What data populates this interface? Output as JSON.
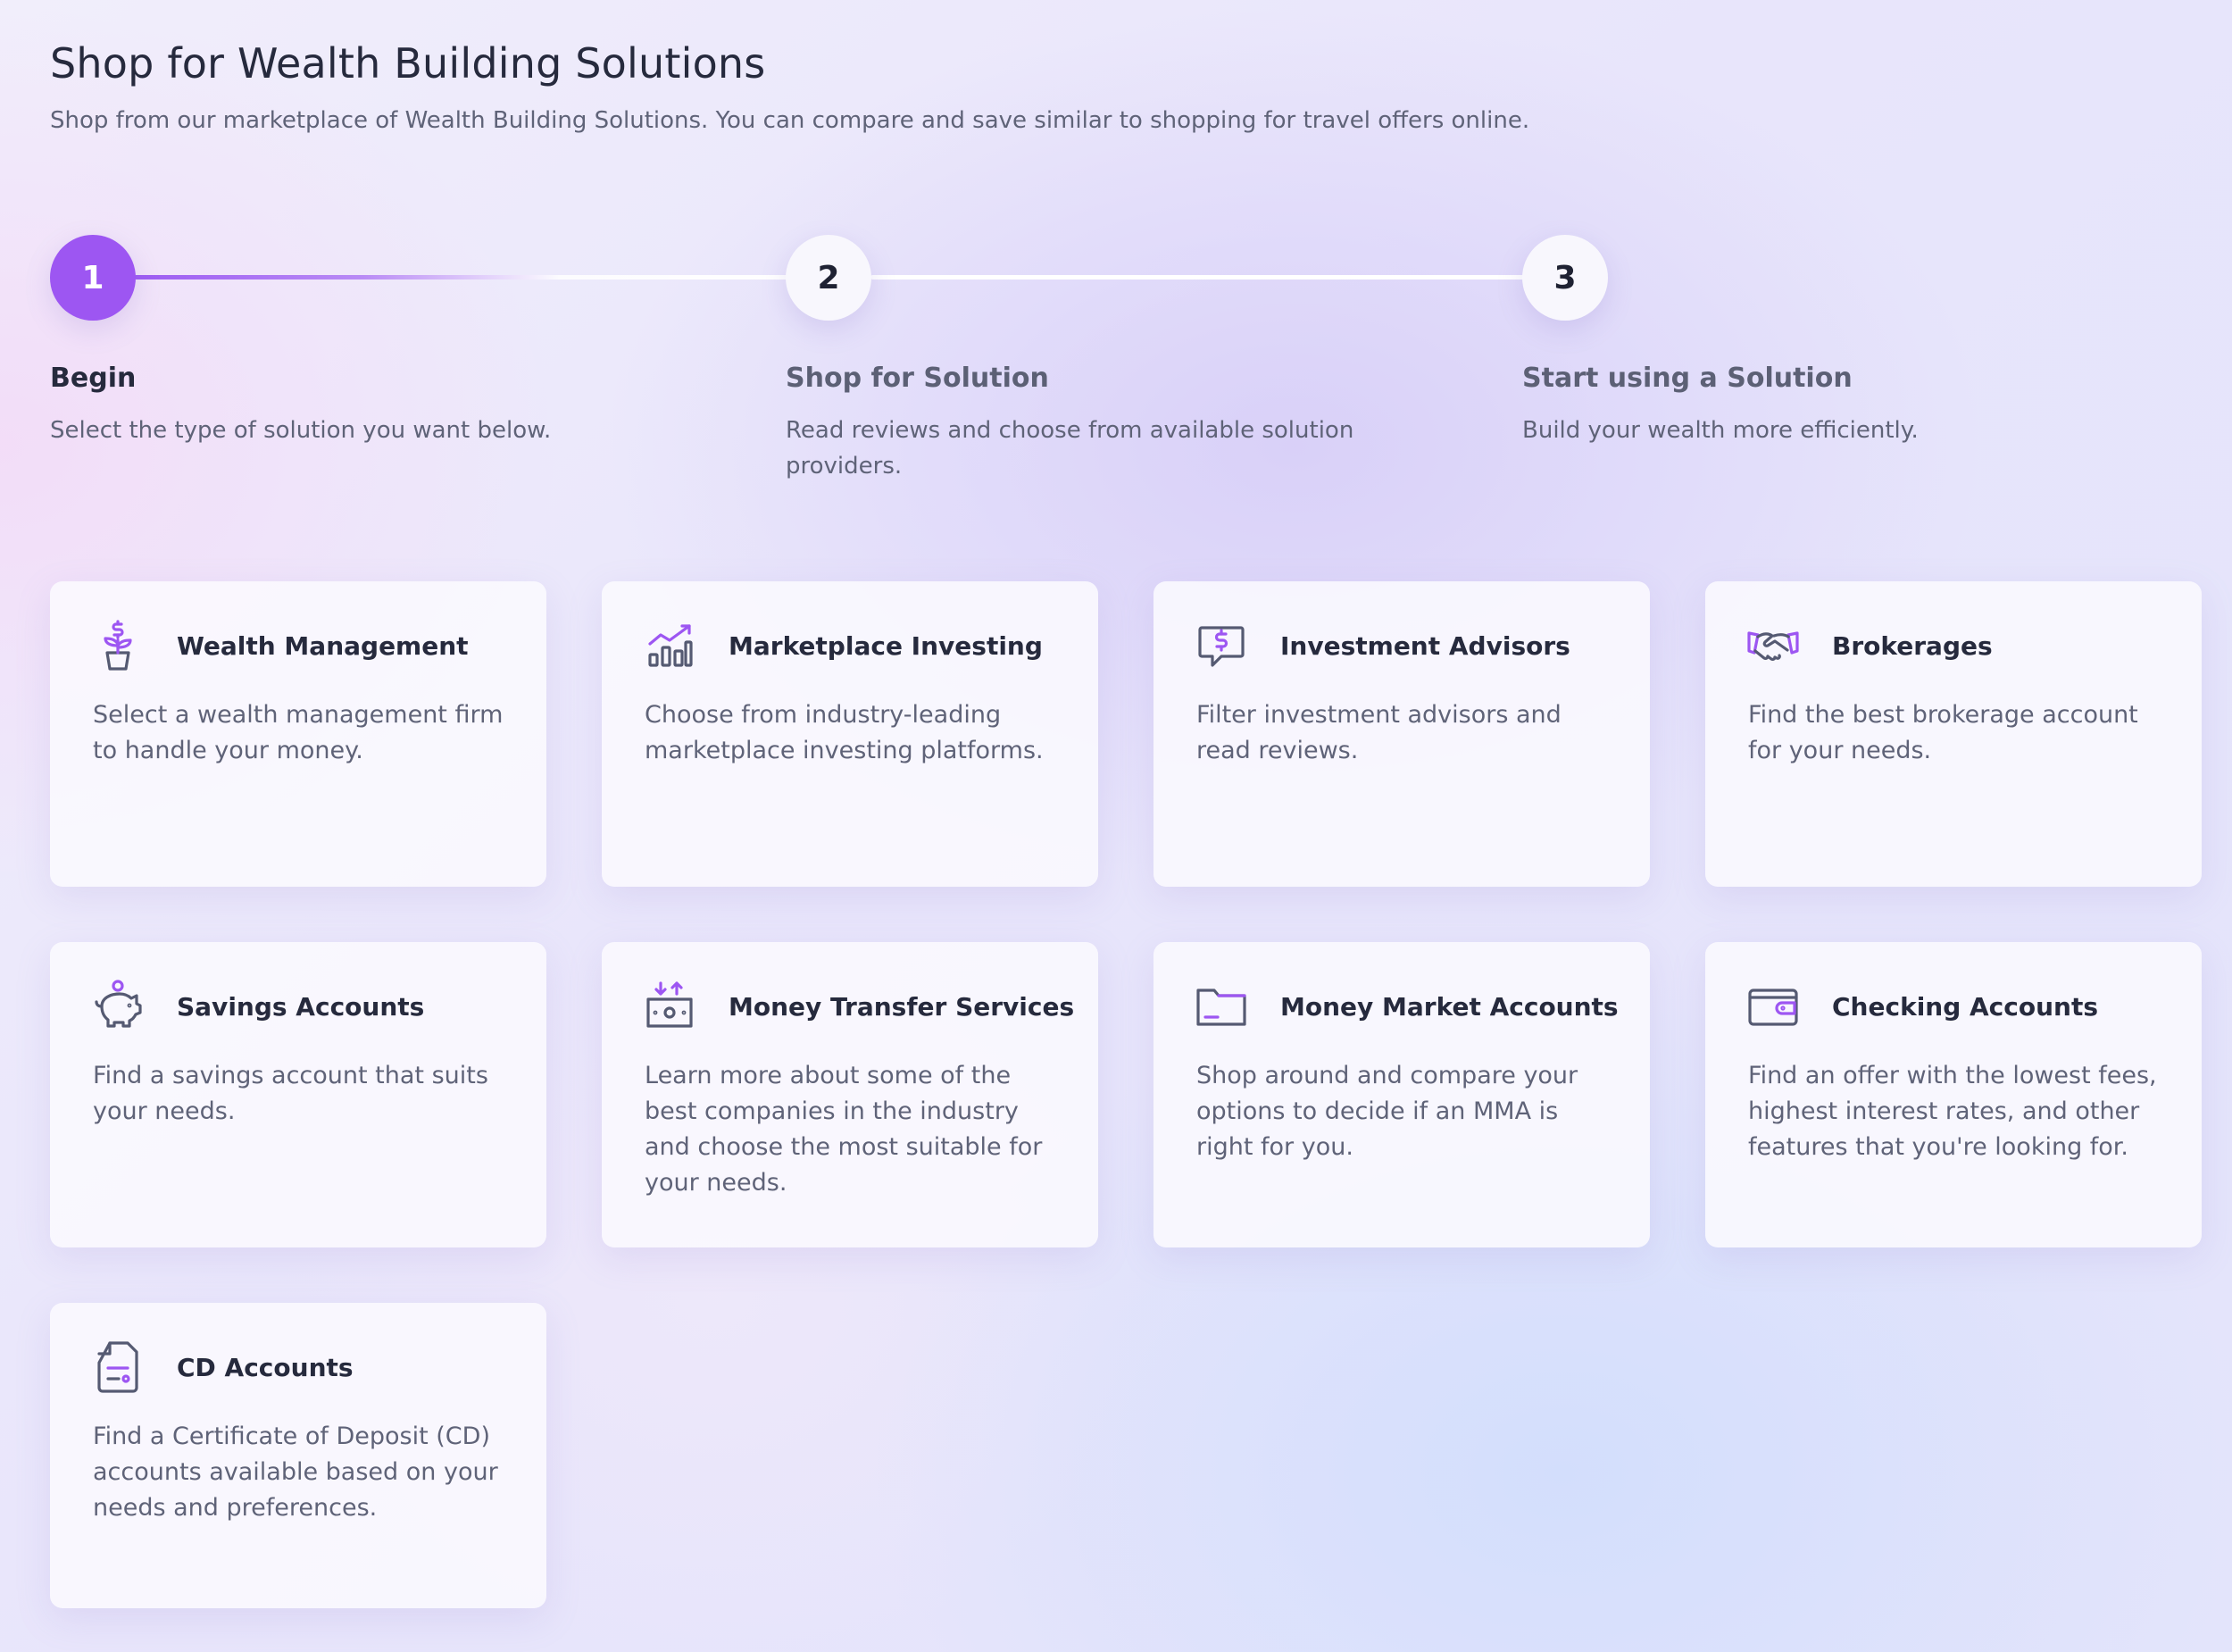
{
  "page": {
    "title": "Shop for Wealth Building Solutions",
    "subtitle": "Shop from our marketplace of Wealth Building Solutions. You can compare and save similar to shopping for travel offers online."
  },
  "colors": {
    "accent": "#9d56f2",
    "text_dark": "#262a3d",
    "text_muted": "#5f6378",
    "icon_gray": "#555a72"
  },
  "steps": [
    {
      "number": "1",
      "title": "Begin",
      "description": "Select the type of solution you want below.",
      "active": true
    },
    {
      "number": "2",
      "title": "Shop for Solution",
      "description": "Read reviews and choose from available solution providers.",
      "active": false
    },
    {
      "number": "3",
      "title": "Start using a Solution",
      "description": "Build your wealth more efficiently.",
      "active": false
    }
  ],
  "solutions": [
    {
      "icon": "plant-dollar-icon",
      "title": "Wealth Management",
      "description": "Select a wealth management firm to handle your money."
    },
    {
      "icon": "bar-chart-trend-icon",
      "title": "Marketplace Investing",
      "description": "Choose from industry-leading marketplace investing platforms."
    },
    {
      "icon": "chat-dollar-icon",
      "title": "Investment Advisors",
      "description": "Filter investment advisors and read reviews."
    },
    {
      "icon": "handshake-icon",
      "title": "Brokerages",
      "description": "Find the best brokerage account for your needs."
    },
    {
      "icon": "piggy-bank-icon",
      "title": "Savings Accounts",
      "description": "Find a savings account that suits your needs."
    },
    {
      "icon": "money-transfer-icon",
      "title": "Money Transfer Services",
      "description": "Learn more about some of the best companies in the industry and choose the most suitable for your needs."
    },
    {
      "icon": "folder-icon",
      "title": "Money Market Accounts",
      "description": "Shop around and compare your options to decide if an MMA is right for you."
    },
    {
      "icon": "wallet-icon",
      "title": "Checking Accounts",
      "description": "Find an offer with the lowest fees, highest interest rates, and other features that you're looking for."
    },
    {
      "icon": "document-settings-icon",
      "title": "CD Accounts",
      "description": "Find a Certificate of Deposit (CD) accounts available based on your needs and preferences."
    }
  ]
}
